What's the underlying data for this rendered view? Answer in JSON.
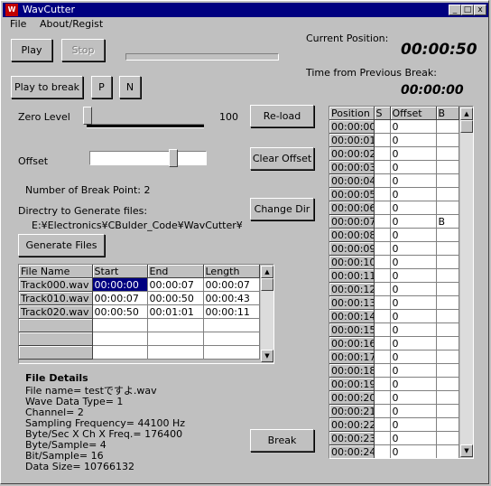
{
  "window": {
    "title": "WavCutter",
    "icon_text": "W",
    "min": "_",
    "max": "□",
    "close": "x"
  },
  "menu": [
    "File",
    "About/Regist"
  ],
  "buttons": {
    "play": "Play",
    "stop": "Stop",
    "play_to_break": "Play to break",
    "p": "P",
    "n": "N",
    "reload": "Re-load",
    "clear_offset": "Clear Offset",
    "change_dir": "Change Dir",
    "generate_files": "Generate Files",
    "break": "Break"
  },
  "labels": {
    "current_position": "Current Position:",
    "current_position_value": "00:00:50",
    "time_from_prev": "Time from Previous Break:",
    "time_from_prev_value": "00:00:00",
    "zero_level": "Zero Level",
    "zero_level_value": "100",
    "offset": "Offset",
    "break_points": "Number of Break Point:  2",
    "dir_label": "Directry to Generate files:",
    "dir_value": "E:¥Electronics¥CBulder_Code¥WavCutter¥"
  },
  "file_table": {
    "headers": [
      "File Name",
      "Start",
      "End",
      "Length"
    ],
    "rows": [
      [
        "Track000.wav",
        "00:00:00",
        "00:00:07",
        "00:00:07"
      ],
      [
        "Track010.wav",
        "00:00:07",
        "00:00:50",
        "00:00:43"
      ],
      [
        "Track020.wav",
        "00:00:50",
        "00:01:01",
        "00:00:11"
      ],
      [
        "",
        "",
        "",
        ""
      ],
      [
        "",
        "",
        "",
        ""
      ],
      [
        "",
        "",
        "",
        ""
      ]
    ]
  },
  "details": {
    "title": "File Details",
    "lines": [
      "File name= testですよ.wav",
      "Wave Data Type= 1",
      "Channel= 2",
      "Sampling Frequency= 44100 Hz",
      "Byte/Sec X Ch X Freq.= 176400",
      "Byte/Sample= 4",
      "Bit/Sample= 16",
      "Data Size= 10766132"
    ]
  },
  "break_table": {
    "headers": [
      "Position",
      "S",
      "Offset",
      "B"
    ],
    "rows": [
      [
        "00:00:00",
        "",
        "0",
        ""
      ],
      [
        "00:00:01",
        "",
        "0",
        ""
      ],
      [
        "00:00:02",
        "",
        "0",
        ""
      ],
      [
        "00:00:03",
        "",
        "0",
        ""
      ],
      [
        "00:00:04",
        "",
        "0",
        ""
      ],
      [
        "00:00:05",
        "",
        "0",
        ""
      ],
      [
        "00:00:06",
        "",
        "0",
        ""
      ],
      [
        "00:00:07",
        "",
        "0",
        "B"
      ],
      [
        "00:00:08",
        "",
        "0",
        ""
      ],
      [
        "00:00:09",
        "",
        "0",
        ""
      ],
      [
        "00:00:10",
        "",
        "0",
        ""
      ],
      [
        "00:00:11",
        "",
        "0",
        ""
      ],
      [
        "00:00:12",
        "",
        "0",
        ""
      ],
      [
        "00:00:13",
        "",
        "0",
        ""
      ],
      [
        "00:00:14",
        "",
        "0",
        ""
      ],
      [
        "00:00:15",
        "",
        "0",
        ""
      ],
      [
        "00:00:16",
        "",
        "0",
        ""
      ],
      [
        "00:00:17",
        "",
        "0",
        ""
      ],
      [
        "00:00:18",
        "",
        "0",
        ""
      ],
      [
        "00:00:19",
        "",
        "0",
        ""
      ],
      [
        "00:00:20",
        "",
        "0",
        ""
      ],
      [
        "00:00:21",
        "",
        "0",
        ""
      ],
      [
        "00:00:22",
        "",
        "0",
        ""
      ],
      [
        "00:00:23",
        "",
        "0",
        ""
      ],
      [
        "00:00:24",
        "",
        "0",
        ""
      ]
    ]
  },
  "icons": {
    "scroll_up": "▲",
    "scroll_down": "▼"
  }
}
